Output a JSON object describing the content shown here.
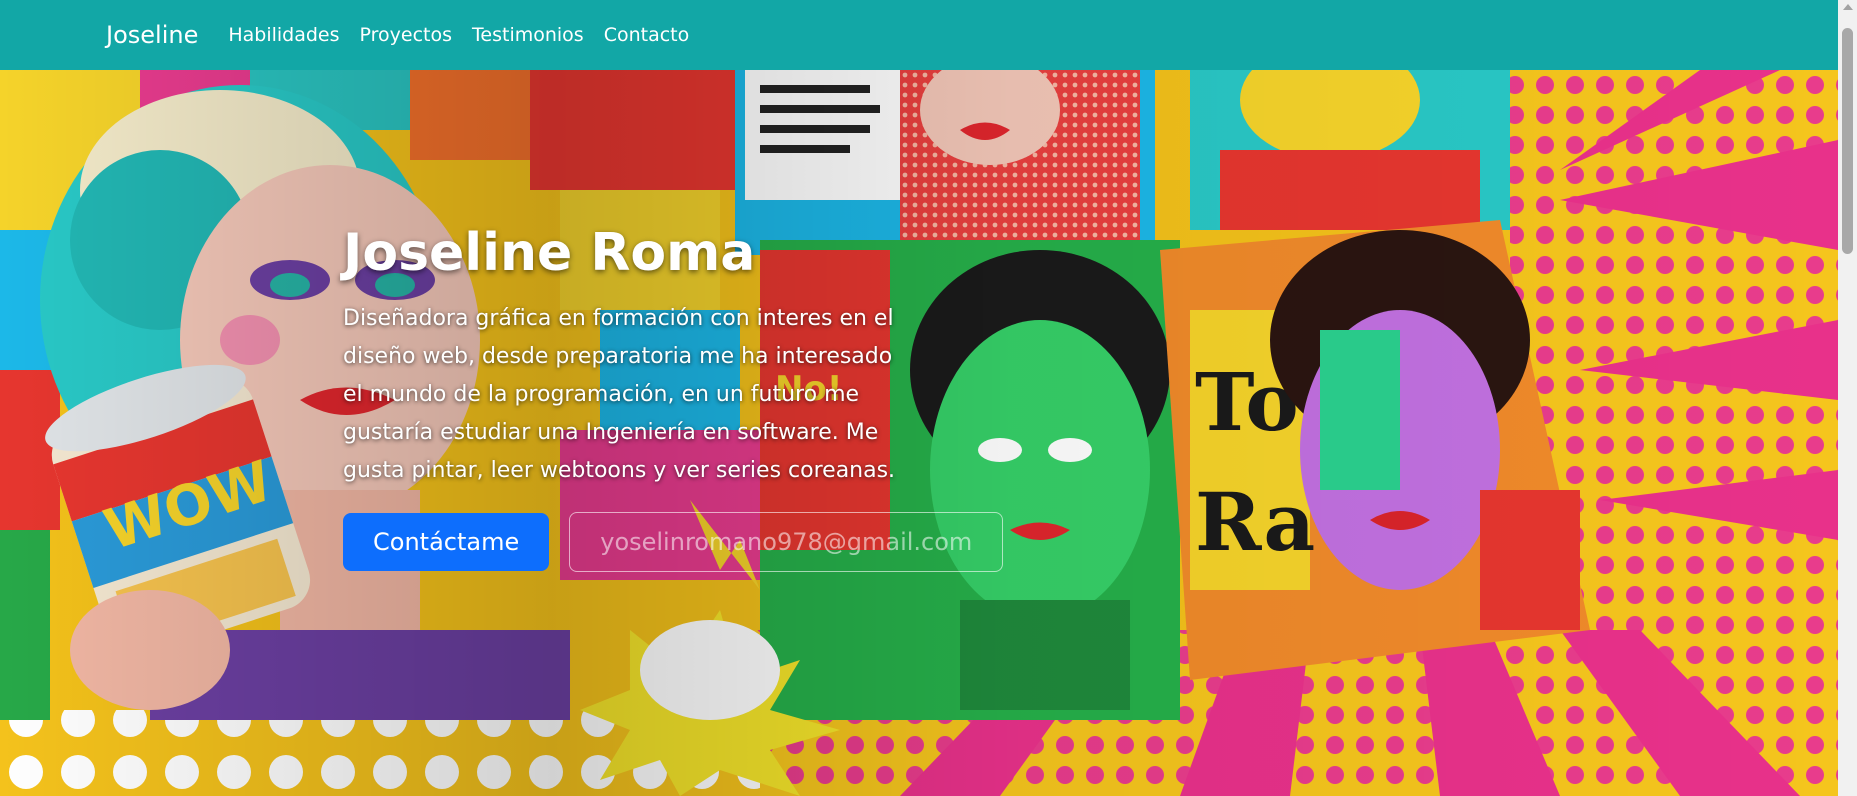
{
  "navbar": {
    "brand": "Joseline",
    "links": [
      "Habilidades",
      "Proyectos",
      "Testimonios",
      "Contacto"
    ]
  },
  "hero": {
    "background_image": "pop-art-collage",
    "title": "Joseline Roma",
    "description": "Diseñadora gráfica en formación con interes en el diseño web, desde preparatoria me ha interesado el mundo de la programación, en un futuro me gustaría estudiar una Ingeniería en software. Me gusta pintar, leer webtoons y ver series coreanas.",
    "primary_button": "Contáctame",
    "email_button": "yoselinromano978@gmail.com"
  },
  "colors": {
    "navbar_bg": "#12a7a6",
    "primary_button": "#0d6efd"
  }
}
